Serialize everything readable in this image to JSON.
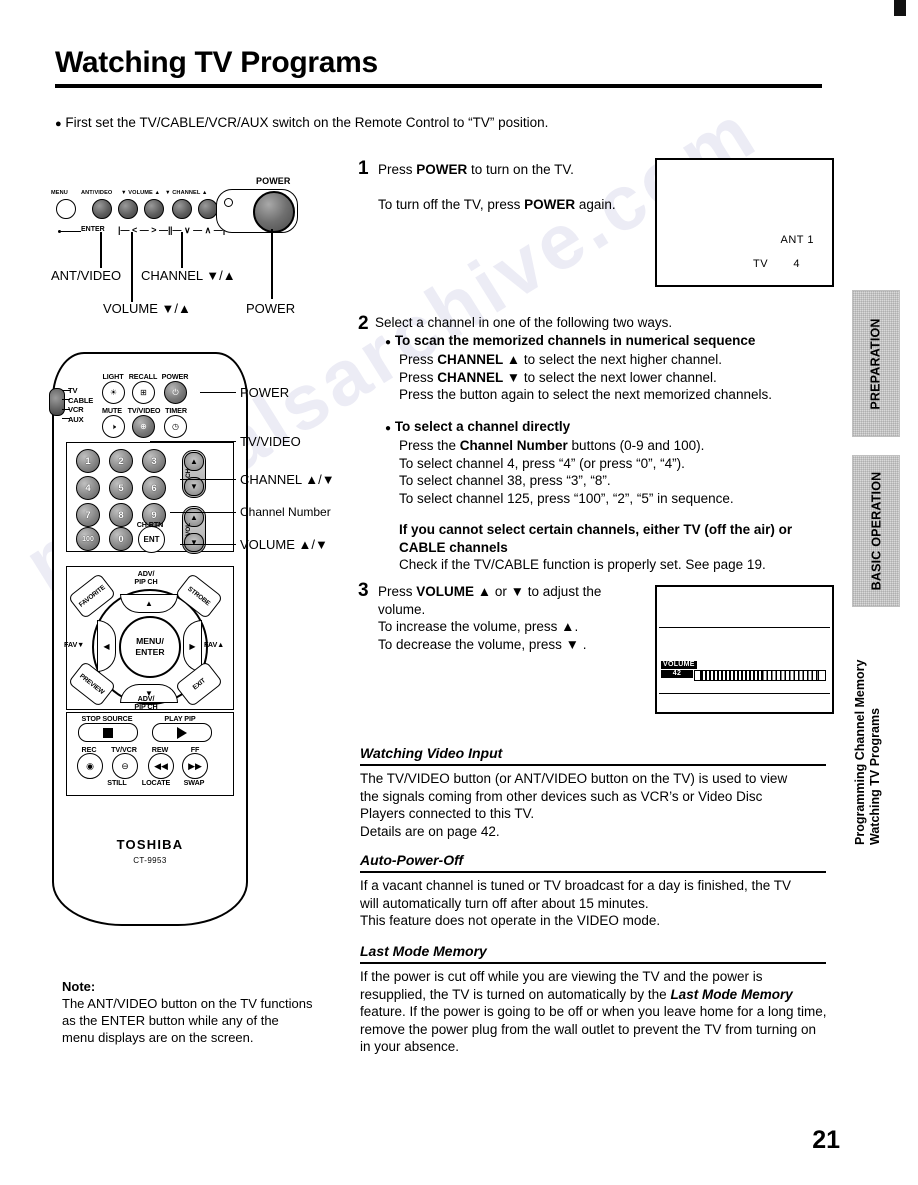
{
  "document": {
    "title": "Watching TV Programs",
    "intro": "First set the TV/CABLE/VCR/AUX switch on the Remote Control to “TV” position.",
    "page_number": "21",
    "watermark": "manualsarchive.com"
  },
  "tv_panel": {
    "button_labels": [
      "MENU",
      "ANT/VIDEO",
      "▼ VOLUME ▲",
      "▼ CHANNEL ▲"
    ],
    "enter_label": "ENTER",
    "volume_bracket": "|— <  —  >  —|",
    "channel_bracket": "|— ∨ — ∧ —|",
    "power_top_label": "POWER",
    "callouts": {
      "ant_video": "ANT/VIDEO",
      "channel": "CHANNEL ▼/▲",
      "volume": "VOLUME ▼/▲",
      "power": "POWER"
    }
  },
  "remote": {
    "brand": "TOSHIBA",
    "model": "CT-9953",
    "mode_switch": [
      "TV",
      "CABLE",
      "VCR",
      "AUX"
    ],
    "top_row_labels": [
      "LIGHT",
      "RECALL",
      "POWER"
    ],
    "second_row_labels": [
      "MUTE",
      "TV/VIDEO",
      "TIMER"
    ],
    "keypad": [
      "1",
      "2",
      "3",
      "4",
      "5",
      "6",
      "7",
      "8",
      "9",
      "100",
      "0"
    ],
    "enter_button": "ENT",
    "enter_caption": "CH.RTN",
    "ch_rocker_label": "CH",
    "vol_rocker_label": "VOL",
    "wheel": {
      "center": [
        "MENU/",
        "ENTER"
      ],
      "top_caption": [
        "ADV/",
        "PIP CH"
      ],
      "bottom_caption": [
        "ADV/",
        "PIP CH"
      ],
      "left_label": "FAV▼",
      "right_label": "FAV▲",
      "corner_top_left": "FAVORITE",
      "corner_top_right": "STROBE",
      "corner_bottom_left": "PREVIEW",
      "corner_bottom_right": "EXIT"
    },
    "transport": {
      "stop": "STOP SOURCE",
      "play": "PLAY PIP",
      "row_top": [
        "REC",
        "TV/VCR",
        "REW",
        "FF"
      ],
      "row_bottom": [
        "STILL",
        "LOCATE",
        "SWAP"
      ]
    },
    "callouts": {
      "power": "POWER",
      "tv_video": "TV/VIDEO",
      "channel": "CHANNEL ▲/▼",
      "channel_number": "Channel Number",
      "volume": "VOLUME ▲/▼"
    }
  },
  "note": {
    "heading": "Note:",
    "lines": [
      "The ANT/VIDEO button on the TV functions",
      "as the ENTER button while any of the",
      "menu displays are on the screen."
    ]
  },
  "steps": [
    {
      "number": "1",
      "lines": [
        "Press POWER to turn on the TV.",
        "To turn off the TV, press POWER again."
      ]
    },
    {
      "number": "2",
      "intro": "Select a channel in one of the following two ways.",
      "group1_heading": "To scan the memorized channels in numerical sequence",
      "group1_lines": [
        "Press CHANNEL ▲ to select the next higher channel.",
        "Press CHANNEL ▼ to select the next lower channel.",
        "Press the button again to select the next memorized channels."
      ],
      "group2_heading": "To select a channel directly",
      "group2_lines": [
        "Press the Channel Number buttons (0-9 and 100).",
        "To select channel 4, press “4” (or press “0”, “4”).",
        "To select channel 38, press “3”, “8”.",
        "To select channel 125, press “100”, “2”, “5” in sequence."
      ],
      "warning_heading": [
        "If you cannot select certain channels, either TV (off the air) or",
        "CABLE channels"
      ],
      "warning_body": "Check if the TV/CABLE function is properly set. See page 19."
    },
    {
      "number": "3",
      "lines": [
        "Press VOLUME ▲ or ▼ to adjust the",
        "volume.",
        "To increase the volume, press ▲.",
        "To decrease the volume, press ▼ ."
      ]
    }
  ],
  "screens": {
    "power_on": {
      "ant": "ANT 1",
      "source": "TV",
      "channel": "4"
    },
    "volume": {
      "label": "VOLUME",
      "value": "42"
    }
  },
  "sections": [
    {
      "heading": "Watching Video Input",
      "body": [
        "The TV/VIDEO button (or ANT/VIDEO button on the TV) is used to view",
        "the signals coming from other devices such as VCR’s or Video Disc",
        "Players connected to this TV.",
        "Details are on page 42."
      ]
    },
    {
      "heading": "Auto-Power-Off",
      "body": [
        "If a vacant channel is tuned or TV broadcast for a day is finished, the TV",
        "will automatically turn off after about 15 minutes.",
        "This feature does not operate in the VIDEO mode."
      ]
    },
    {
      "heading": "Last Mode Memory",
      "body_html": "If the power is cut off while you are viewing the TV and the power is resupplied, the TV is turned on automatically by the <i>Last Mode Memory</i> feature. If the power is going to be off or when you leave home for a long time, remove the power plug from the wall outlet to prevent the TV from turning on in your absence."
    }
  ],
  "side_tabs": [
    {
      "label": "PREPARATION"
    },
    {
      "label": "BASIC OPERATION"
    }
  ],
  "side_text": [
    "Programming Channel Memory",
    "Watching TV Programs"
  ]
}
